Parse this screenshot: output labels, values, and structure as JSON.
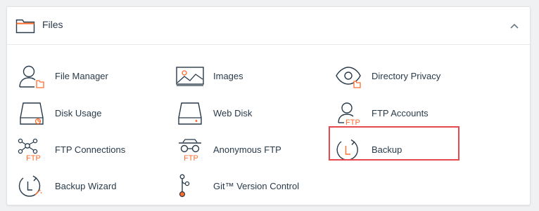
{
  "section": {
    "title": "Files",
    "icon": "folder-icon",
    "collapse_icon": "chevron-up-icon"
  },
  "items": [
    {
      "label": "File Manager",
      "icon": "file-manager-icon"
    },
    {
      "label": "Images",
      "icon": "images-icon"
    },
    {
      "label": "Directory Privacy",
      "icon": "directory-privacy-icon"
    },
    {
      "label": "Disk Usage",
      "icon": "disk-usage-icon"
    },
    {
      "label": "Web Disk",
      "icon": "web-disk-icon"
    },
    {
      "label": "FTP Accounts",
      "icon": "ftp-accounts-icon"
    },
    {
      "label": "FTP Connections",
      "icon": "ftp-connections-icon"
    },
    {
      "label": "Anonymous FTP",
      "icon": "anonymous-ftp-icon"
    },
    {
      "label": "Backup",
      "icon": "backup-icon"
    },
    {
      "label": "Backup Wizard",
      "icon": "backup-wizard-icon"
    },
    {
      "label": "Git™ Version Control",
      "icon": "git-icon"
    }
  ],
  "icon_text": {
    "ftp": "FTP"
  },
  "colors": {
    "text": "#293a4a",
    "icon_stroke": "#293a4a",
    "accent": "#ff6c2c",
    "highlight_border": "#e5484d"
  }
}
